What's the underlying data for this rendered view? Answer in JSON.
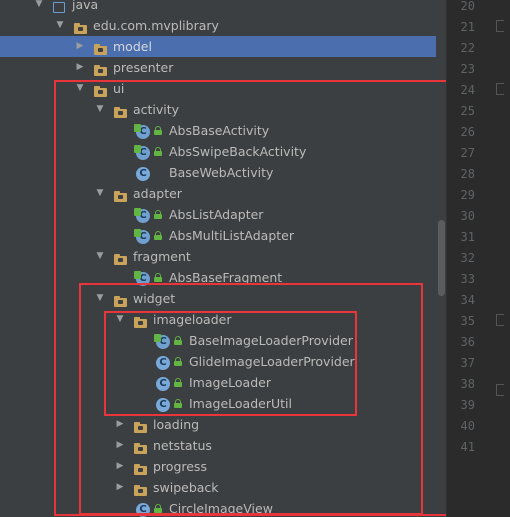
{
  "tree": {
    "rows": [
      {
        "label": "java",
        "icon": "module-folder-icon",
        "expanded": true
      },
      {
        "label": "edu.com.mvplibrary",
        "icon": "package-icon",
        "expanded": true
      },
      {
        "label": "model",
        "icon": "package-icon",
        "expanded": false,
        "selected": true
      },
      {
        "label": "presenter",
        "icon": "package-icon",
        "expanded": false
      },
      {
        "label": "ui",
        "icon": "package-icon",
        "expanded": true
      },
      {
        "label": "activity",
        "icon": "package-icon",
        "expanded": true
      },
      {
        "label": "AbsBaseActivity",
        "icon": "abstract-class-icon"
      },
      {
        "label": "AbsSwipeBackActivity",
        "icon": "abstract-class-icon"
      },
      {
        "label": "BaseWebActivity",
        "icon": "class-icon"
      },
      {
        "label": "adapter",
        "icon": "package-icon",
        "expanded": true
      },
      {
        "label": "AbsListAdapter",
        "icon": "abstract-class-icon"
      },
      {
        "label": "AbsMultiListAdapter",
        "icon": "abstract-class-icon"
      },
      {
        "label": "fragment",
        "icon": "package-icon",
        "expanded": true
      },
      {
        "label": "AbsBaseFragment",
        "icon": "abstract-class-icon"
      },
      {
        "label": "widget",
        "icon": "package-icon",
        "expanded": true
      },
      {
        "label": "imageloader",
        "icon": "package-icon",
        "expanded": true
      },
      {
        "label": "BaseImageLoaderProvider",
        "icon": "abstract-class-icon"
      },
      {
        "label": "GlideImageLoaderProvider",
        "icon": "class-icon"
      },
      {
        "label": "ImageLoader",
        "icon": "class-icon"
      },
      {
        "label": "ImageLoaderUtil",
        "icon": "class-icon"
      },
      {
        "label": "loading",
        "icon": "package-icon",
        "expanded": false
      },
      {
        "label": "netstatus",
        "icon": "package-icon",
        "expanded": false
      },
      {
        "label": "progress",
        "icon": "package-icon",
        "expanded": false
      },
      {
        "label": "swipeback",
        "icon": "package-icon",
        "expanded": false
      },
      {
        "label": "CircleImageView",
        "icon": "class-icon"
      }
    ]
  },
  "gutter": {
    "line_numbers": [
      "20",
      "21",
      "22",
      "23",
      "24",
      "25",
      "26",
      "27",
      "28",
      "29",
      "30",
      "31",
      "32",
      "33",
      "34",
      "35",
      "36",
      "37",
      "38",
      "39",
      "40",
      "41"
    ]
  },
  "colors": {
    "highlight_box": "#e8353c",
    "selection": "#4b6eaf",
    "folder": "#c9a35a",
    "class_icon": "#79a9d8",
    "lock": "#62b543"
  }
}
